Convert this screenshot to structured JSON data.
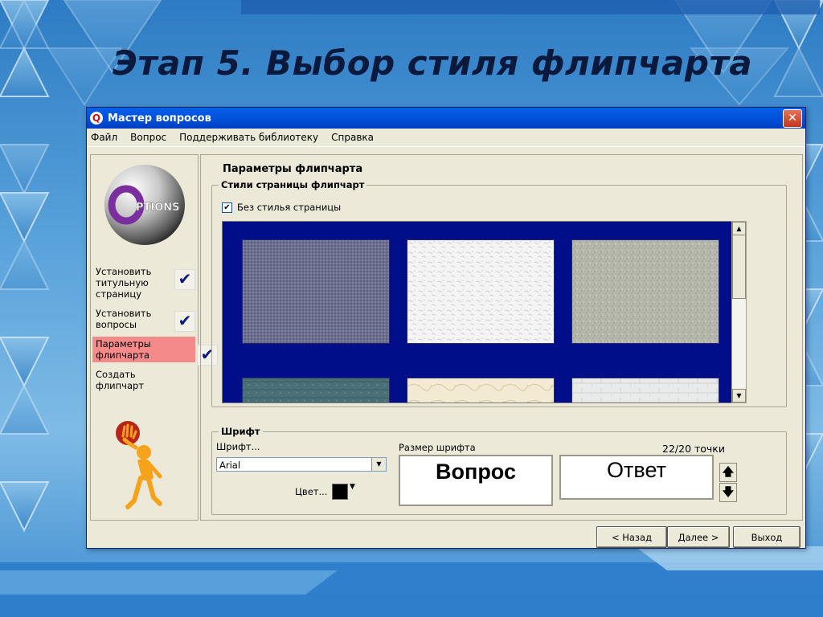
{
  "slide": {
    "title": "Этап 5. Выбор стиля флипчарта"
  },
  "window": {
    "title": "Мастер вопросов",
    "app_icon": "Q",
    "close_glyph": "✕"
  },
  "menu": [
    "Файл",
    "Вопрос",
    "Поддерживать библиотеку",
    "Справка"
  ],
  "left_pane": {
    "logo_text": "PTIONS",
    "steps": [
      {
        "label": "Установить титульную страницу",
        "checked": true,
        "active": false
      },
      {
        "label": "Установить вопросы",
        "checked": true,
        "active": false
      },
      {
        "label": "Параметры флипчарта",
        "checked": true,
        "active": true
      },
      {
        "label": "Создать флипчарт",
        "checked": false,
        "active": false
      }
    ],
    "check_glyph": "✔"
  },
  "params": {
    "title": "Параметры флипчарта",
    "styles_group": "Стили страницы флипчарт",
    "no_style_label": "Без стилья страницы",
    "no_style_checked": true,
    "check_mark": "✔",
    "textures": [
      "purple-linen",
      "white-stucco",
      "grey-granite",
      "teal-leather",
      "cream-marble",
      "white-brick"
    ]
  },
  "font": {
    "group": "Шрифт",
    "font_label": "Шрифт...",
    "font_value": "Arial",
    "size_label": "Размер шрифта",
    "size_value": "22/20 точки",
    "color_label": "Цвет...",
    "color_value": "#000000",
    "preview_question": "Вопрос",
    "preview_answer": "Ответ",
    "up_glyph": "🡅",
    "down_glyph": "🡇"
  },
  "nav": {
    "back": "< Назад",
    "next": "Далее >",
    "exit": "Выход"
  },
  "colors": {
    "accent_active_step": "#f48a8a",
    "texture_panel_bg": "#000e8a",
    "window_bg": "#ece9d8"
  }
}
